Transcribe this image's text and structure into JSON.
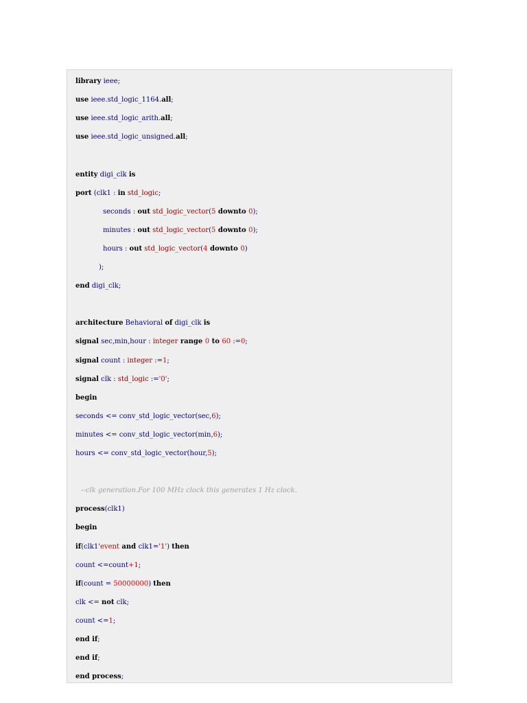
{
  "code": {
    "language": "VHDL",
    "lines": [
      [
        {
          "c": "kw",
          "t": "library"
        },
        {
          "c": "id",
          "t": " ieee"
        },
        {
          "c": "pun",
          "t": ";"
        }
      ],
      [
        {
          "c": "kw",
          "t": "use"
        },
        {
          "c": "id",
          "t": " ieee.std_logic_1164."
        },
        {
          "c": "kw",
          "t": "all"
        },
        {
          "c": "pun",
          "t": ";"
        }
      ],
      [
        {
          "c": "kw",
          "t": "use"
        },
        {
          "c": "id",
          "t": " ieee.std_logic_arith."
        },
        {
          "c": "kw",
          "t": "all"
        },
        {
          "c": "pun",
          "t": ";"
        }
      ],
      [
        {
          "c": "kw",
          "t": "use"
        },
        {
          "c": "id",
          "t": " ieee.std_logic_unsigned."
        },
        {
          "c": "kw",
          "t": "all"
        },
        {
          "c": "pun",
          "t": ";"
        }
      ],
      [],
      [
        {
          "c": "kw",
          "t": "entity"
        },
        {
          "c": "id",
          "t": " digi_clk "
        },
        {
          "c": "kw",
          "t": "is"
        }
      ],
      [
        {
          "c": "kw",
          "t": "port"
        },
        {
          "c": "pun",
          "t": " ("
        },
        {
          "c": "id",
          "t": "clk1 : "
        },
        {
          "c": "kw",
          "t": "in"
        },
        {
          "c": "ty",
          "t": " std_logic"
        },
        {
          "c": "pun",
          "t": ";"
        }
      ],
      [
        {
          "c": "id",
          "t": "seconds : "
        },
        {
          "c": "kw",
          "t": "out"
        },
        {
          "c": "ty",
          "t": " std_logic_vector"
        },
        {
          "c": "pun",
          "t": "("
        },
        {
          "c": "num",
          "t": "5"
        },
        {
          "c": "kw",
          "t": " downto "
        },
        {
          "c": "num",
          "t": "0"
        },
        {
          "c": "pun",
          "t": ");"
        }
      ],
      [
        {
          "c": "id",
          "t": "minutes : "
        },
        {
          "c": "kw",
          "t": "out"
        },
        {
          "c": "ty",
          "t": " std_logic_vector"
        },
        {
          "c": "pun",
          "t": "("
        },
        {
          "c": "num",
          "t": "5"
        },
        {
          "c": "kw",
          "t": " downto "
        },
        {
          "c": "num",
          "t": "0"
        },
        {
          "c": "pun",
          "t": ");"
        }
      ],
      [
        {
          "c": "id",
          "t": "hours : "
        },
        {
          "c": "kw",
          "t": "out"
        },
        {
          "c": "ty",
          "t": " std_logic_vector"
        },
        {
          "c": "pun",
          "t": "("
        },
        {
          "c": "num",
          "t": "4"
        },
        {
          "c": "kw",
          "t": " downto "
        },
        {
          "c": "num",
          "t": "0"
        },
        {
          "c": "pun",
          "t": ")"
        }
      ],
      [
        {
          "c": "pun",
          "t": ");"
        }
      ],
      [
        {
          "c": "kw",
          "t": "end"
        },
        {
          "c": "id",
          "t": " digi_clk"
        },
        {
          "c": "pun",
          "t": ";"
        }
      ],
      [],
      [
        {
          "c": "kw",
          "t": "architecture"
        },
        {
          "c": "id",
          "t": " Behavioral "
        },
        {
          "c": "kw",
          "t": "of"
        },
        {
          "c": "id",
          "t": " digi_clk "
        },
        {
          "c": "kw",
          "t": "is"
        }
      ],
      [
        {
          "c": "kw",
          "t": "signal"
        },
        {
          "c": "id",
          "t": " sec,min,hour : "
        },
        {
          "c": "ty",
          "t": "integer"
        },
        {
          "c": "kw",
          "t": " range "
        },
        {
          "c": "num",
          "t": "0"
        },
        {
          "c": "kw",
          "t": " to "
        },
        {
          "c": "num",
          "t": "60"
        },
        {
          "c": "id",
          "t": " :="
        },
        {
          "c": "num",
          "t": "0"
        },
        {
          "c": "pun",
          "t": ";"
        }
      ],
      [
        {
          "c": "kw",
          "t": "signal"
        },
        {
          "c": "id",
          "t": " count : "
        },
        {
          "c": "ty",
          "t": "integer"
        },
        {
          "c": "id",
          "t": " :="
        },
        {
          "c": "num",
          "t": "1"
        },
        {
          "c": "pun",
          "t": ";"
        }
      ],
      [
        {
          "c": "kw",
          "t": "signal"
        },
        {
          "c": "id",
          "t": " clk : "
        },
        {
          "c": "ty",
          "t": "std_logic"
        },
        {
          "c": "id",
          "t": " :="
        },
        {
          "c": "str",
          "t": "'0'"
        },
        {
          "c": "pun",
          "t": ";"
        }
      ],
      [
        {
          "c": "kw",
          "t": "begin"
        }
      ],
      [
        {
          "c": "id",
          "t": "seconds <= conv_std_logic_vector"
        },
        {
          "c": "pun",
          "t": "("
        },
        {
          "c": "id",
          "t": "sec,"
        },
        {
          "c": "num",
          "t": "6"
        },
        {
          "c": "pun",
          "t": ");"
        }
      ],
      [
        {
          "c": "id",
          "t": "minutes <= conv_std_logic_vector"
        },
        {
          "c": "pun",
          "t": "("
        },
        {
          "c": "id",
          "t": "min,"
        },
        {
          "c": "num",
          "t": "6"
        },
        {
          "c": "pun",
          "t": ");"
        }
      ],
      [
        {
          "c": "id",
          "t": "hours <= conv_std_logic_vector"
        },
        {
          "c": "pun",
          "t": "("
        },
        {
          "c": "id",
          "t": "hour,"
        },
        {
          "c": "num",
          "t": "5"
        },
        {
          "c": "pun",
          "t": ");"
        }
      ],
      [],
      [
        {
          "c": "cm",
          "t": "--clk generation.For 100 MHz clock this generates 1 Hz clock."
        }
      ],
      [
        {
          "c": "kw",
          "t": "process"
        },
        {
          "c": "pun",
          "t": "("
        },
        {
          "c": "id",
          "t": "clk1"
        },
        {
          "c": "pun",
          "t": ")"
        }
      ],
      [
        {
          "c": "kw",
          "t": "begin"
        }
      ],
      [
        {
          "c": "kw",
          "t": "if"
        },
        {
          "c": "pun",
          "t": "("
        },
        {
          "c": "id",
          "t": "clk1"
        },
        {
          "c": "str",
          "t": "'event"
        },
        {
          "c": "kw",
          "t": " and "
        },
        {
          "c": "id",
          "t": "clk1="
        },
        {
          "c": "str",
          "t": "'1'"
        },
        {
          "c": "pun",
          "t": ") "
        },
        {
          "c": "kw",
          "t": "then"
        }
      ],
      [
        {
          "c": "id",
          "t": "count <=count"
        },
        {
          "c": "num",
          "t": "+1"
        },
        {
          "c": "pun",
          "t": ";"
        }
      ],
      [
        {
          "c": "kw",
          "t": "if"
        },
        {
          "c": "pun",
          "t": "("
        },
        {
          "c": "id",
          "t": "count = "
        },
        {
          "c": "num",
          "t": "50000000"
        },
        {
          "c": "pun",
          "t": ") "
        },
        {
          "c": "kw",
          "t": "then"
        }
      ],
      [
        {
          "c": "id",
          "t": "clk <= "
        },
        {
          "c": "kw",
          "t": "not"
        },
        {
          "c": "id",
          "t": " clk"
        },
        {
          "c": "pun",
          "t": ";"
        }
      ],
      [
        {
          "c": "id",
          "t": "count <="
        },
        {
          "c": "num",
          "t": "1"
        },
        {
          "c": "pun",
          "t": ";"
        }
      ],
      [
        {
          "c": "kw",
          "t": "end if"
        },
        {
          "c": "pun",
          "t": ";"
        }
      ],
      [
        {
          "c": "kw",
          "t": "end if"
        },
        {
          "c": "pun",
          "t": ";"
        }
      ],
      [
        {
          "c": "kw",
          "t": "end process"
        },
        {
          "c": "pun",
          "t": ";"
        }
      ]
    ]
  }
}
